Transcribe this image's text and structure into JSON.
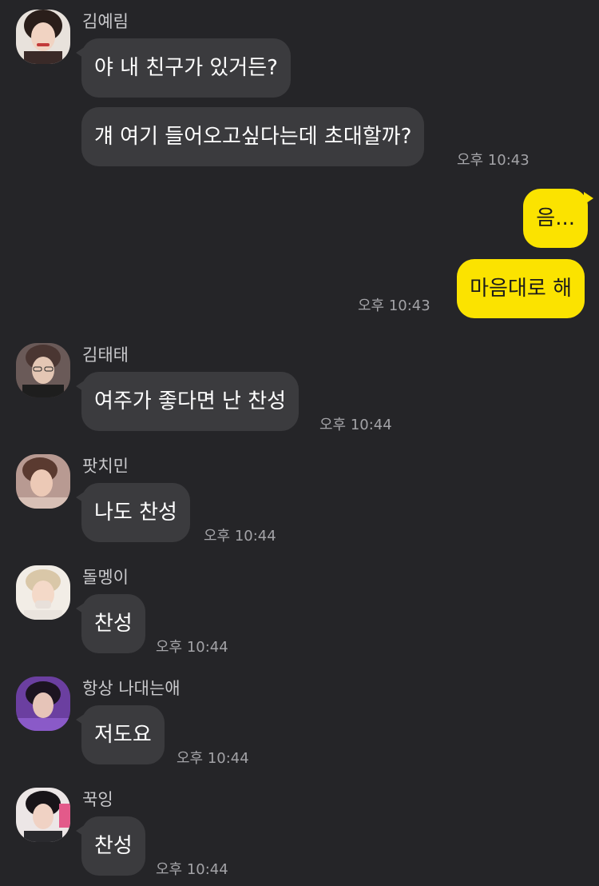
{
  "me": {
    "messages": [
      {
        "text": "음..."
      },
      {
        "text": "마음대로 해"
      }
    ],
    "time": "오후 10:43"
  },
  "others": [
    {
      "name": "김예림",
      "messages": [
        {
          "text": "야 내 친구가 있거든?"
        },
        {
          "text": "걔 여기 들어오고싶다는데 초대할까?"
        }
      ],
      "time": "오후 10:43"
    },
    {
      "name": "김태태",
      "messages": [
        {
          "text": "여주가 좋다면 난 찬성"
        }
      ],
      "time": "오후 10:44"
    },
    {
      "name": "팟치민",
      "messages": [
        {
          "text": "나도 찬성"
        }
      ],
      "time": "오후 10:44"
    },
    {
      "name": "돌멩이",
      "messages": [
        {
          "text": "찬성"
        }
      ],
      "time": "오후 10:44"
    },
    {
      "name": "항상 나대는애",
      "messages": [
        {
          "text": "저도요"
        }
      ],
      "time": "오후 10:44"
    },
    {
      "name": "꾹잉",
      "messages": [
        {
          "text": "찬성"
        }
      ],
      "time": "오후 10:44"
    }
  ],
  "colors": {
    "background": "#252528",
    "incoming_bubble": "#3b3b3e",
    "outgoing_bubble": "#fbe300",
    "timestamp": "#a3a3a7"
  }
}
